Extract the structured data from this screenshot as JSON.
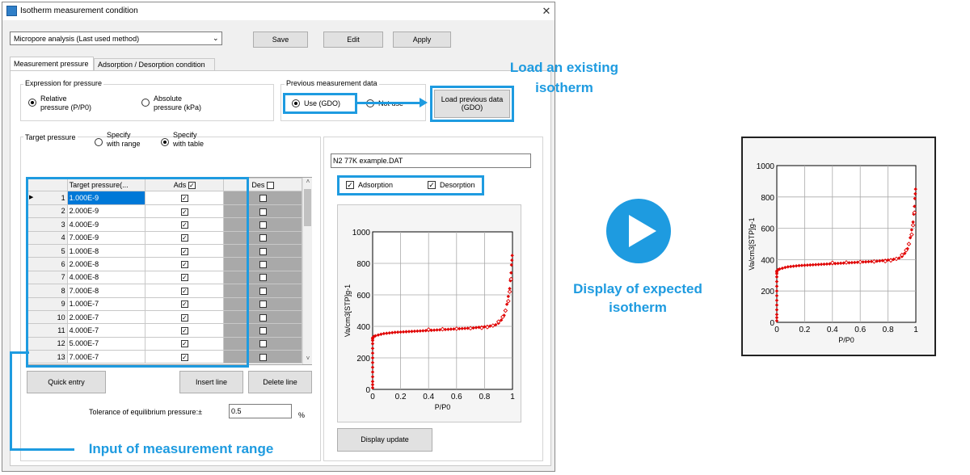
{
  "window": {
    "title": "Isotherm measurement condition",
    "close": "✕"
  },
  "toolbar": {
    "method": "Micropore analysis (Last used method)",
    "save": "Save",
    "edit": "Edit",
    "apply": "Apply"
  },
  "tabs": [
    "Measurement pressure",
    "Adsorption / Desorption condition"
  ],
  "pressure_expr": {
    "label": "Expression for pressure",
    "relative_l1": "Relative",
    "relative_l2": "pressure (P/P0)",
    "absolute_l1": "Absolute",
    "absolute_l2": "pressure (kPa)",
    "selected": "relative"
  },
  "previous": {
    "label": "Previous measurement data",
    "use": "Use (GDO)",
    "not_use": "Not use",
    "load_l1": "Load previous data",
    "load_l2": "(GDO)",
    "selected": "use"
  },
  "target": {
    "label": "Target pressure",
    "range_l1": "Specify",
    "range_l2": "with range",
    "table_l1": "Specify",
    "table_l2": "with table",
    "selected": "table"
  },
  "grid": {
    "headers": [
      "Target pressure(...",
      "Ads",
      "Des"
    ],
    "ads_header_checked": true,
    "des_header_checked": false,
    "rows": [
      {
        "n": "1",
        "p": "1.000E-9",
        "ads": true,
        "des": false
      },
      {
        "n": "2",
        "p": "2.000E-9",
        "ads": true,
        "des": false
      },
      {
        "n": "3",
        "p": "4.000E-9",
        "ads": true,
        "des": false
      },
      {
        "n": "4",
        "p": "7.000E-9",
        "ads": true,
        "des": false
      },
      {
        "n": "5",
        "p": "1.000E-8",
        "ads": true,
        "des": false
      },
      {
        "n": "6",
        "p": "2.000E-8",
        "ads": true,
        "des": false
      },
      {
        "n": "7",
        "p": "4.000E-8",
        "ads": true,
        "des": false
      },
      {
        "n": "8",
        "p": "7.000E-8",
        "ads": true,
        "des": false
      },
      {
        "n": "9",
        "p": "1.000E-7",
        "ads": true,
        "des": false
      },
      {
        "n": "10",
        "p": "2.000E-7",
        "ads": true,
        "des": false
      },
      {
        "n": "11",
        "p": "4.000E-7",
        "ads": true,
        "des": false
      },
      {
        "n": "12",
        "p": "5.000E-7",
        "ads": true,
        "des": false
      },
      {
        "n": "13",
        "p": "7.000E-7",
        "ads": true,
        "des": false
      }
    ]
  },
  "buttons": {
    "quick_entry": "Quick entry",
    "insert_line": "Insert line",
    "delete_line": "Delete line",
    "display_update": "Display update"
  },
  "tolerance": {
    "label": "Tolerance of equilibrium pressure:±",
    "value": "0.5",
    "unit": "%"
  },
  "file": {
    "name": "N2 77K example.DAT",
    "adsorption": "Adsorption",
    "desorption": "Desorption"
  },
  "annotations": {
    "load_l1": "Load an existing",
    "load_l2": "isotherm",
    "input_range": "Input of measurement range",
    "display_l1": "Display of expected",
    "display_l2": "isotherm"
  },
  "colors": {
    "accent": "#1e9be0",
    "series": "#e00000",
    "selection": "#0078d7"
  },
  "chart_data": {
    "type": "scatter",
    "xlabel": "P/P0",
    "ylabel": "Va/cm3[STP]g-1",
    "xlim": [
      0,
      1
    ],
    "ylim": [
      0,
      1000
    ],
    "xticks": [
      "0",
      "0.2",
      "0.4",
      "0.6",
      "0.8",
      "1"
    ],
    "yticks": [
      "0",
      "200",
      "400",
      "600",
      "800",
      "1000"
    ],
    "grid": true,
    "series": [
      {
        "marker": "filled-diamond",
        "x": [
          0.0,
          0.0,
          0.0,
          0.0,
          0.0,
          0.0,
          0.0,
          0.0,
          0.0,
          0.0,
          0.0,
          0.0,
          0.0,
          0.0,
          0.005,
          0.01,
          0.02,
          0.04,
          0.06,
          0.08,
          0.1,
          0.12,
          0.14,
          0.16,
          0.18,
          0.2,
          0.22,
          0.24,
          0.26,
          0.28,
          0.3,
          0.32,
          0.34,
          0.36,
          0.38,
          0.4,
          0.42,
          0.44,
          0.46,
          0.48,
          0.5,
          0.52,
          0.54,
          0.56,
          0.58,
          0.6,
          0.62,
          0.64,
          0.66,
          0.68,
          0.7,
          0.72,
          0.74,
          0.76,
          0.78,
          0.8,
          0.82,
          0.84,
          0.86,
          0.88,
          0.9,
          0.92,
          0.94,
          0.95,
          0.96,
          0.97,
          0.98,
          0.985,
          0.99,
          0.993,
          0.996,
          0.998
        ],
        "y": [
          10,
          30,
          50,
          80,
          110,
          140,
          170,
          200,
          230,
          260,
          290,
          310,
          320,
          328,
          332,
          336,
          340,
          345,
          350,
          354,
          356,
          358,
          360,
          362,
          363,
          364,
          365,
          366,
          367,
          368,
          369,
          370,
          371,
          372,
          373,
          374,
          375,
          376,
          377,
          378,
          379,
          380,
          381,
          382,
          383,
          384,
          385,
          386,
          387,
          388,
          389,
          390,
          392,
          394,
          396,
          398,
          400,
          402,
          405,
          410,
          420,
          440,
          470,
          500,
          540,
          590,
          640,
          690,
          740,
          790,
          820,
          850
        ]
      },
      {
        "marker": "open-diamond",
        "x": [
          0.4,
          0.5,
          0.6,
          0.7,
          0.78,
          0.82,
          0.86,
          0.9,
          0.93,
          0.95,
          0.97,
          0.98,
          0.99
        ],
        "y": [
          380,
          382,
          385,
          388,
          390,
          395,
          405,
          430,
          460,
          500,
          560,
          620,
          700
        ]
      }
    ]
  }
}
